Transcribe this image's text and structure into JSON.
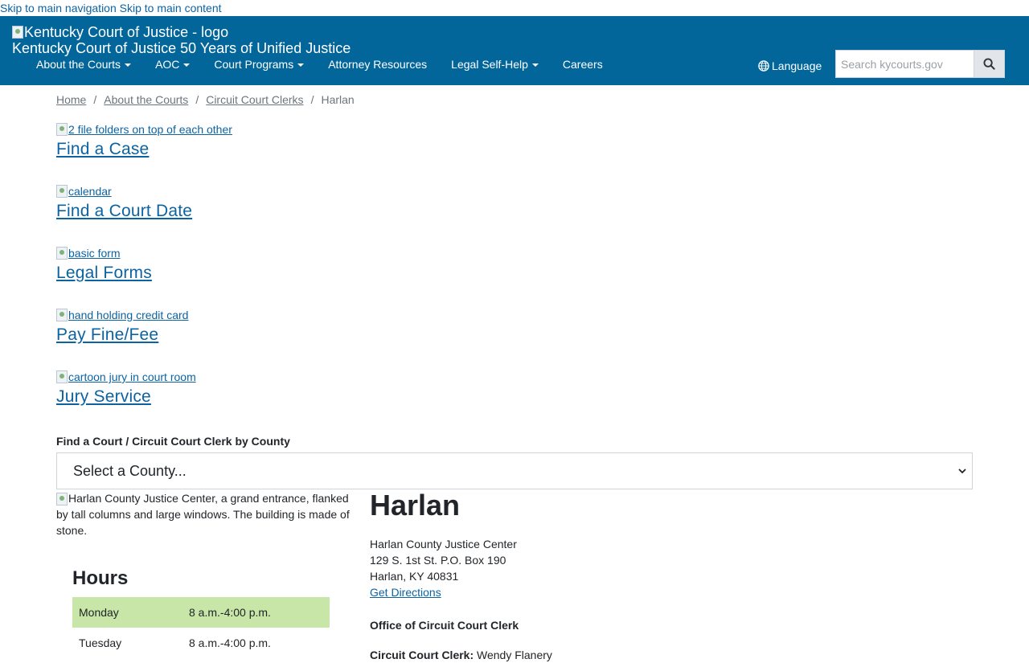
{
  "skip": {
    "nav": "Skip to main navigation",
    "content": "Skip to main content"
  },
  "header": {
    "logo_alt": "Kentucky Court of Justice - logo",
    "site_name": "Kentucky Court of Justice 50 Years of Unified Justice",
    "nav": [
      {
        "label": "About the Courts",
        "dropdown": true
      },
      {
        "label": "AOC",
        "dropdown": true
      },
      {
        "label": "Court Programs",
        "dropdown": true
      },
      {
        "label": "Attorney Resources",
        "dropdown": false
      },
      {
        "label": "Legal Self-Help",
        "dropdown": true
      },
      {
        "label": "Careers",
        "dropdown": false
      }
    ],
    "language": "Language",
    "search_placeholder": "Search kycourts.gov",
    "brand_color": "#03669b"
  },
  "breadcrumb": [
    "Home",
    "About the Courts",
    "Circuit Court Clerks",
    "Harlan"
  ],
  "quick_links": [
    {
      "img_alt": "2 file folders on top of each other",
      "title": "Find a Case"
    },
    {
      "img_alt": "calendar",
      "title": "Find a Court Date"
    },
    {
      "img_alt": "basic form",
      "title": "Legal Forms"
    },
    {
      "img_alt": "hand holding credit card",
      "title": "Pay Fine/Fee"
    },
    {
      "img_alt": "cartoon jury in court room",
      "title": "Jury Service"
    }
  ],
  "county_finder": {
    "label": "Find a Court / Circuit Court Clerk by County",
    "selected": "Select a County..."
  },
  "court": {
    "photo_alt": "Harlan County Justice Center, a grand entrance, flanked by tall columns and large windows. The building is made of stone.",
    "name": "Harlan",
    "address": [
      "Harlan County Justice Center",
      "129 S. 1st St. P.O. Box 190",
      "Harlan, KY 40831"
    ],
    "directions": "Get Directions",
    "office_title": "Office of Circuit Court Clerk",
    "clerk_label": "Circuit Court Clerk:",
    "clerk_name": "Wendy Flanery"
  },
  "hours": {
    "title": "Hours",
    "rows": [
      {
        "day": "Monday",
        "time": "8 a.m.-4:00 p.m.",
        "highlight": true
      },
      {
        "day": "Tuesday",
        "time": "8 a.m.-4:00 p.m.",
        "highlight": false
      }
    ],
    "highlight_color": "#c8e6a7"
  }
}
